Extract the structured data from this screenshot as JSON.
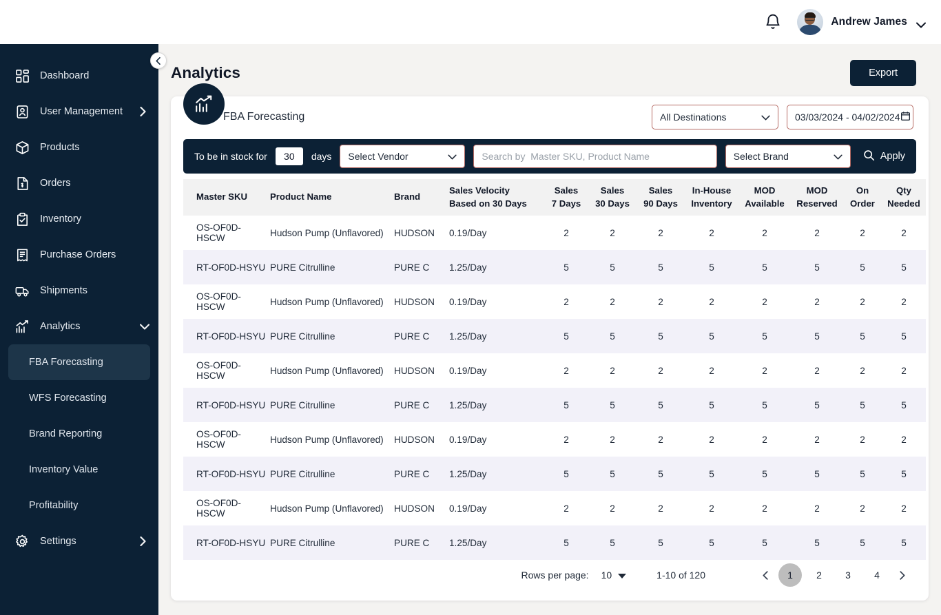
{
  "topbar": {
    "notification_icon": "bell-icon",
    "user_name": "Andrew James",
    "caret_icon": "chevron-down-icon"
  },
  "sidebar": {
    "collapse_icon": "chevron-left-icon",
    "items": [
      {
        "label": "Dashboard",
        "icon": "dashboard-grid-icon",
        "has_arrow": false
      },
      {
        "label": "User Management",
        "icon": "user-badge-icon",
        "has_arrow": true
      },
      {
        "label": "Products",
        "icon": "box-icon",
        "has_arrow": false
      },
      {
        "label": "Orders",
        "icon": "invoice-icon",
        "has_arrow": false
      },
      {
        "label": "Inventory",
        "icon": "clipboard-check-icon",
        "has_arrow": false
      },
      {
        "label": "Purchase Orders",
        "icon": "receipt-icon",
        "has_arrow": false
      },
      {
        "label": "Shipments",
        "icon": "truck-icon",
        "has_arrow": false
      },
      {
        "label": "Analytics",
        "icon": "chart-line-icon",
        "has_arrow": true,
        "expanded": true
      }
    ],
    "analytics_children": [
      {
        "label": "FBA Forecasting",
        "active": true
      },
      {
        "label": "WFS Forecasting",
        "active": false
      },
      {
        "label": "Brand Reporting",
        "active": false
      },
      {
        "label": "Inventory Value",
        "active": false
      },
      {
        "label": "Profitability",
        "active": false
      }
    ],
    "settings": {
      "label": "Settings",
      "icon": "gear-icon",
      "has_arrow": true
    }
  },
  "page": {
    "title": "Analytics",
    "export_label": "Export"
  },
  "card": {
    "icon": "analytics-chart-icon",
    "title": "FBA Forecasting",
    "destination_select": "All Destinations",
    "destination_caret": "chevron-down-icon",
    "date_range": "03/03/2024 - 04/02/2024",
    "calendar_icon": "calendar-icon"
  },
  "filters": {
    "stock_label_prefix": "To be in stock for",
    "stock_days_value": "30",
    "stock_label_suffix": "days",
    "vendor_select": "Select Vendor",
    "vendor_caret": "chevron-down-icon",
    "search_placeholder": "Search by  Master SKU, Product Name",
    "search_value": "",
    "brand_select": "Select Brand",
    "brand_caret": "chevron-down-icon",
    "apply_label": "Apply",
    "apply_icon": "search-icon"
  },
  "table": {
    "columns": [
      "Master SKU",
      "Product Name",
      "Brand",
      "Sales Velocity\nBased on 30 Days",
      "Sales\n7 Days",
      "Sales\n30 Days",
      "Sales\n90 Days",
      "In-House\nInventory",
      "MOD\nAvailable",
      "MOD\nReserved",
      "On\nOrder",
      "Qty\nNeeded"
    ],
    "column_lines": [
      [
        "Master SKU",
        ""
      ],
      [
        "Product Name",
        ""
      ],
      [
        "Brand",
        ""
      ],
      [
        "Sales Velocity",
        "Based on 30 Days"
      ],
      [
        "Sales",
        "7 Days"
      ],
      [
        "Sales",
        "30 Days"
      ],
      [
        "Sales",
        "90 Days"
      ],
      [
        "In-House",
        "Inventory"
      ],
      [
        "MOD",
        "Available"
      ],
      [
        "MOD",
        "Reserved"
      ],
      [
        "On",
        "Order"
      ],
      [
        "Qty",
        "Needed"
      ]
    ],
    "rows": [
      {
        "sku": "OS-OF0D-HSCW",
        "name": "Hudson Pump (Unflavored)",
        "brand": "HUDSON",
        "velocity": "0.19/Day",
        "s7": "2",
        "s30": "2",
        "s90": "2",
        "inhouse": "2",
        "mod_avail": "2",
        "mod_res": "2",
        "on_order": "2",
        "qty": "2"
      },
      {
        "sku": "RT-OF0D-HSYU",
        "name": "PURE Citrulline",
        "brand": "PURE C",
        "velocity": "1.25/Day",
        "s7": "5",
        "s30": "5",
        "s90": "5",
        "inhouse": "5",
        "mod_avail": "5",
        "mod_res": "5",
        "on_order": "5",
        "qty": "5"
      },
      {
        "sku": "OS-OF0D-HSCW",
        "name": "Hudson Pump (Unflavored)",
        "brand": "HUDSON",
        "velocity": "0.19/Day",
        "s7": "2",
        "s30": "2",
        "s90": "2",
        "inhouse": "2",
        "mod_avail": "2",
        "mod_res": "2",
        "on_order": "2",
        "qty": "2"
      },
      {
        "sku": "RT-OF0D-HSYU",
        "name": "PURE Citrulline",
        "brand": "PURE C",
        "velocity": "1.25/Day",
        "s7": "5",
        "s30": "5",
        "s90": "5",
        "inhouse": "5",
        "mod_avail": "5",
        "mod_res": "5",
        "on_order": "5",
        "qty": "5"
      },
      {
        "sku": "OS-OF0D-HSCW",
        "name": "Hudson Pump (Unflavored)",
        "brand": "HUDSON",
        "velocity": "0.19/Day",
        "s7": "2",
        "s30": "2",
        "s90": "2",
        "inhouse": "2",
        "mod_avail": "2",
        "mod_res": "2",
        "on_order": "2",
        "qty": "2"
      },
      {
        "sku": "RT-OF0D-HSYU",
        "name": "PURE Citrulline",
        "brand": "PURE C",
        "velocity": "1.25/Day",
        "s7": "5",
        "s30": "5",
        "s90": "5",
        "inhouse": "5",
        "mod_avail": "5",
        "mod_res": "5",
        "on_order": "5",
        "qty": "5"
      },
      {
        "sku": "OS-OF0D-HSCW",
        "name": "Hudson Pump (Unflavored)",
        "brand": "HUDSON",
        "velocity": "0.19/Day",
        "s7": "2",
        "s30": "2",
        "s90": "2",
        "inhouse": "2",
        "mod_avail": "2",
        "mod_res": "2",
        "on_order": "2",
        "qty": "2"
      },
      {
        "sku": "RT-OF0D-HSYU",
        "name": "PURE Citrulline",
        "brand": "PURE C",
        "velocity": "1.25/Day",
        "s7": "5",
        "s30": "5",
        "s90": "5",
        "inhouse": "5",
        "mod_avail": "5",
        "mod_res": "5",
        "on_order": "5",
        "qty": "5"
      },
      {
        "sku": "OS-OF0D-HSCW",
        "name": "Hudson Pump (Unflavored)",
        "brand": "HUDSON",
        "velocity": "0.19/Day",
        "s7": "2",
        "s30": "2",
        "s90": "2",
        "inhouse": "2",
        "mod_avail": "2",
        "mod_res": "2",
        "on_order": "2",
        "qty": "2"
      },
      {
        "sku": "RT-OF0D-HSYU",
        "name": "PURE Citrulline",
        "brand": "PURE C",
        "velocity": "1.25/Day",
        "s7": "5",
        "s30": "5",
        "s90": "5",
        "inhouse": "5",
        "mod_avail": "5",
        "mod_res": "5",
        "on_order": "5",
        "qty": "5"
      }
    ]
  },
  "pagination": {
    "rows_per_page_label": "Rows per page:",
    "rows_per_page_value": "10",
    "rows_caret": "caret-down-icon",
    "range_text": "1-10 of 120",
    "prev_icon": "chevron-left-icon",
    "next_icon": "chevron-right-icon",
    "pages": [
      "1",
      "2",
      "3",
      "4"
    ],
    "current_page": "1"
  },
  "colors": {
    "sidebar_bg": "#0c2135",
    "page_bg": "#f4f3f1",
    "accent_outline": "#b56a63",
    "row_alt": "#f2f1f9",
    "header_row": "#f2f2f2",
    "active_page": "#bdbdbd"
  }
}
